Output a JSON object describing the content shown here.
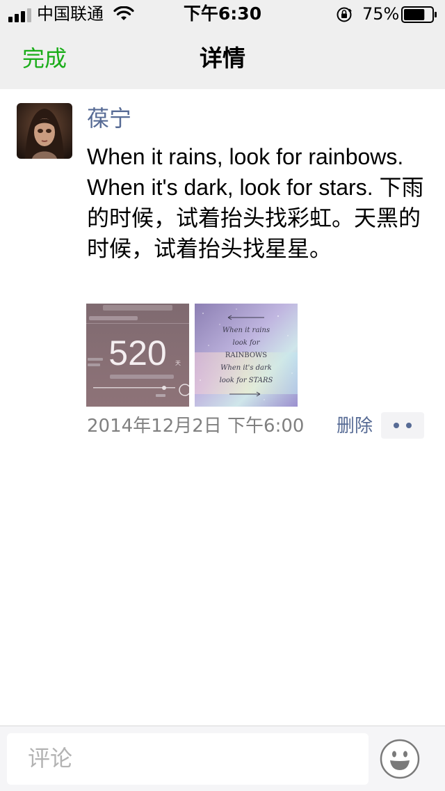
{
  "status_bar": {
    "carrier": "中国联通",
    "time": "下午6:30",
    "battery": "75%",
    "battery_level": 0.75,
    "signal_bars": 3,
    "icons": [
      "signal-icon",
      "wifi-icon",
      "orientation-lock-icon",
      "battery-icon"
    ]
  },
  "nav": {
    "done_label": "完成",
    "title": "详情"
  },
  "post": {
    "author": "葆宁",
    "text": "When it rains, look for rainbows. When it's dark, look for stars. 下雨的时候，试着抬头找彩虹。天黑的时候，试着抬头找星星。",
    "photos": [
      {
        "number": "520",
        "day_unit": "天"
      },
      {
        "lines": [
          "When it rains",
          "look for",
          "RAINBOWS",
          "When it's dark",
          "look for STARS"
        ]
      }
    ],
    "time": "2014年12月2日 下午6:00",
    "delete_label": "删除"
  },
  "comment_bar": {
    "placeholder": "评论",
    "emoji_icon": "smiley-icon"
  },
  "colors": {
    "accent_green": "#1aad19",
    "link_blue": "#576b95",
    "bar_gray": "#efefef"
  }
}
